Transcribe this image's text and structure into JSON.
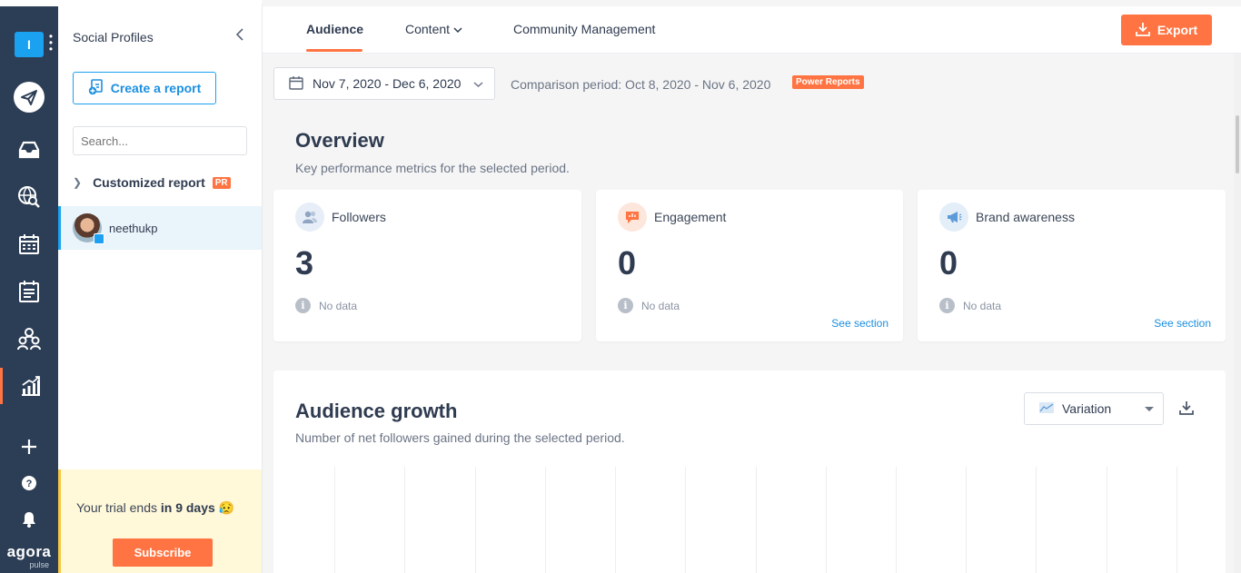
{
  "rail": {
    "logo_letter": "I",
    "brand_name": "agora",
    "brand_sub": "pulse"
  },
  "panel": {
    "title": "Social Profiles",
    "create_report": "Create a report",
    "search_placeholder": "Search...",
    "customized_report": "Customized report",
    "pr_badge": "PR",
    "profile_name": "neethukp",
    "trial_text": "Your trial ends",
    "trial_days": "in 9 days",
    "trial_emoji": "😥",
    "subscribe": "Subscribe"
  },
  "topnav": {
    "tabs": [
      "Audience",
      "Content",
      "Community Management"
    ],
    "content_chevron": "⌄",
    "export": "Export"
  },
  "filters": {
    "date_range": "Nov 7, 2020 - Dec 6, 2020",
    "comparison": "Comparison period: Oct 8, 2020 - Nov 6, 2020",
    "power_badge": "Power Reports"
  },
  "overview": {
    "title": "Overview",
    "subtitle": "Key performance metrics for the selected period.",
    "cards": [
      {
        "label": "Followers",
        "value": "3",
        "note": "No data",
        "link": ""
      },
      {
        "label": "Engagement",
        "value": "0",
        "note": "No data",
        "link": "See section"
      },
      {
        "label": "Brand awareness",
        "value": "0",
        "note": "No data",
        "link": "See section"
      }
    ]
  },
  "growth": {
    "title": "Audience growth",
    "subtitle": "Number of net followers gained during the selected period.",
    "metric_select": "Variation"
  },
  "colors": {
    "accent": "#ff7442",
    "link": "#1a8fe0",
    "rail_bg": "#2c3e55"
  }
}
